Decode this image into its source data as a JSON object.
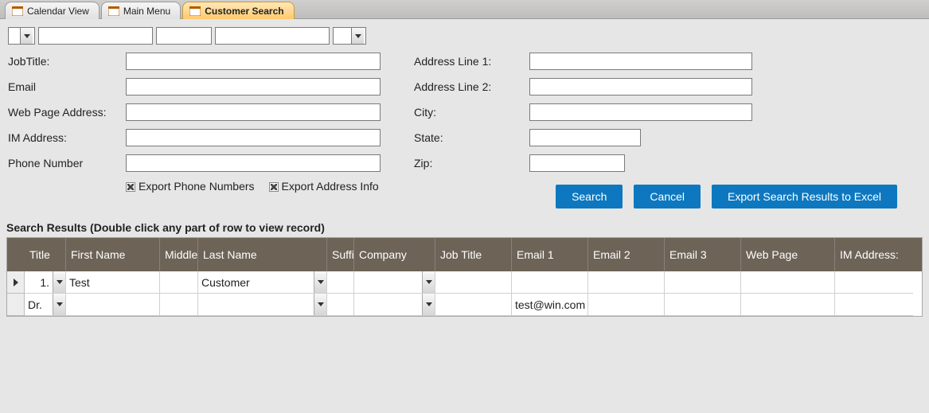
{
  "tabs": [
    {
      "label": "Calendar View",
      "active": false
    },
    {
      "label": "Main Menu",
      "active": false
    },
    {
      "label": "Customer Search",
      "active": true
    }
  ],
  "topRow": {
    "combo1_value": "",
    "field1_value": "",
    "field2_value": "",
    "field3_value": "",
    "combo2_value": ""
  },
  "leftFields": {
    "jobtitle_label": "JobTitle:",
    "jobtitle_value": "",
    "email_label": "Email",
    "email_value": "",
    "webpage_label": "Web Page Address:",
    "webpage_value": "",
    "im_label": "IM Address:",
    "im_value": "",
    "phone_label": "Phone Number",
    "phone_value": ""
  },
  "rightFields": {
    "addr1_label": "Address Line 1:",
    "addr1_value": "",
    "addr2_label": "Address Line 2:",
    "addr2_value": "",
    "city_label": "City:",
    "city_value": "",
    "state_label": "State:",
    "state_value": "",
    "zip_label": "Zip:",
    "zip_value": ""
  },
  "checks": {
    "export_phone_label": "Export Phone Numbers",
    "export_addr_label": "Export Address Info"
  },
  "buttons": {
    "search": "Search",
    "cancel": "Cancel",
    "export": "Export Search Results to Excel"
  },
  "results_heading": "Search Results (Double click any part of row to view record)",
  "columns": {
    "title": "Title",
    "first": "First Name",
    "middle": "Middle",
    "last": "Last Name",
    "suffix": "Suffix",
    "company": "Company",
    "jobtitle": "Job Title",
    "email1": "Email 1",
    "email2": "Email 2",
    "email3": "Email 3",
    "webpage": "Web Page",
    "im": "IM Address:"
  },
  "rows": [
    {
      "selected": true,
      "title": "1.",
      "first": "Test",
      "middle": "",
      "last": "Customer",
      "suffix": "",
      "company": "",
      "jobtitle": "",
      "email1": "",
      "email2": "",
      "email3": "",
      "webpage": "",
      "im": ""
    },
    {
      "selected": false,
      "title": "Dr.",
      "first": "",
      "middle": "",
      "last": "",
      "suffix": "",
      "company": "",
      "jobtitle": "",
      "email1": "test@win.com",
      "email2": "",
      "email3": "",
      "webpage": "",
      "im": ""
    }
  ]
}
